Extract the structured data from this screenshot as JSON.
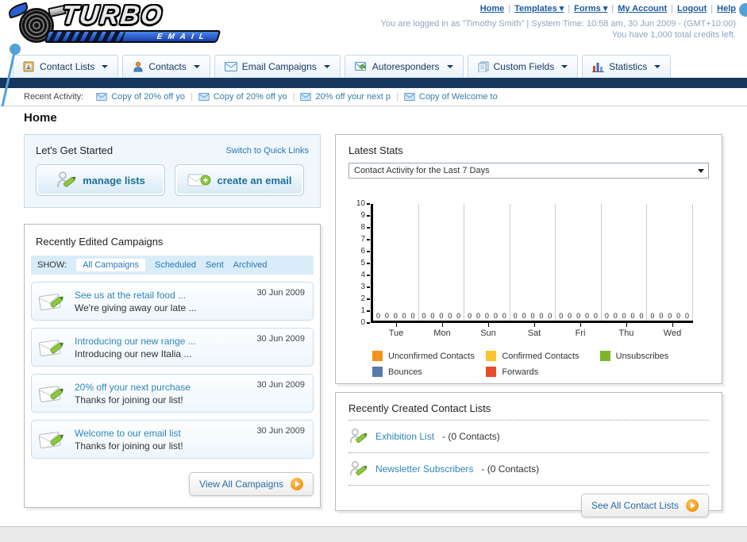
{
  "header": {
    "logo": {
      "title": "TURBO",
      "subtitle": "EMAIL"
    },
    "separator": "|",
    "nav_links": [
      {
        "label": "Home"
      },
      {
        "label": "Templates ▾"
      },
      {
        "label": "Forms ▾"
      },
      {
        "label": "My Account"
      },
      {
        "label": "Logout"
      },
      {
        "label": "Help"
      }
    ],
    "login_info": "You are logged in as \"Timothy Smith\" | System Time: 10:58 am, 30 Jun 2009 - (GMT+10:00)",
    "credits": "You have 1,000 total credits left."
  },
  "tabs": [
    {
      "label": "Contact Lists"
    },
    {
      "label": "Contacts"
    },
    {
      "label": "Email Campaigns"
    },
    {
      "label": "Autoresponders"
    },
    {
      "label": "Custom Fields"
    },
    {
      "label": "Statistics"
    }
  ],
  "activity": {
    "label": "Recent Activity:",
    "items": [
      {
        "label": "Copy of 20% off yo"
      },
      {
        "label": "Copy of 20% off yo"
      },
      {
        "label": "20% off your next p"
      },
      {
        "label": "Copy of Welcome to"
      }
    ]
  },
  "page_title": "Home",
  "get_started": {
    "title": "Let's Get Started",
    "switch_link": "Switch to Quick Links",
    "buttons": [
      {
        "label": "manage lists"
      },
      {
        "label": "create an email"
      }
    ]
  },
  "campaigns": {
    "title": "Recently Edited Campaigns",
    "show_label": "SHOW:",
    "filters": [
      "All Campaigns",
      "Scheduled",
      "Sent",
      "Archived"
    ],
    "active_filter": "All Campaigns",
    "items": [
      {
        "title": "See us at the retail food ...",
        "subtitle": "We're giving away our late ...",
        "date": "30 Jun 2009"
      },
      {
        "title": "Introducing our new range ...",
        "subtitle": "Introducing our new Italia ...",
        "date": "30 Jun 2009"
      },
      {
        "title": "20% off your next purchase",
        "subtitle": "Thanks for joining our list!",
        "date": "30 Jun 2009"
      },
      {
        "title": "Welcome to our email list",
        "subtitle": "Thanks for joining our list!",
        "date": "30 Jun 2009"
      }
    ],
    "view_all_label": "View All Campaigns"
  },
  "stats": {
    "title": "Latest Stats",
    "dropdown_value": "Contact Activity for the Last 7 Days"
  },
  "chart_data": {
    "type": "bar",
    "title": "Contact Activity for the Last 7 Days",
    "categories": [
      "Tue",
      "Mon",
      "Sun",
      "Sat",
      "Fri",
      "Thu",
      "Wed"
    ],
    "series": [
      {
        "name": "Unconfirmed Contacts",
        "color": "#f5921e",
        "values": [
          0,
          0,
          0,
          0,
          0,
          0,
          0
        ]
      },
      {
        "name": "Confirmed Contacts",
        "color": "#fbc32d",
        "values": [
          0,
          0,
          0,
          0,
          0,
          0,
          0
        ]
      },
      {
        "name": "Unsubscribes",
        "color": "#7fb42a",
        "values": [
          0,
          0,
          0,
          0,
          0,
          0,
          0
        ]
      },
      {
        "name": "Bounces",
        "color": "#5878ae",
        "values": [
          0,
          0,
          0,
          0,
          0,
          0,
          0
        ]
      },
      {
        "name": "Forwards",
        "color": "#e74c28",
        "values": [
          0,
          0,
          0,
          0,
          0,
          0,
          0
        ]
      }
    ],
    "xlabel": "",
    "ylabel": "",
    "ylim": [
      0,
      10
    ],
    "yticks": [
      0,
      1,
      2,
      3,
      4,
      5,
      6,
      7,
      8,
      9,
      10
    ],
    "grid": true,
    "legend_position": "bottom"
  },
  "contact_lists": {
    "title": "Recently Created Contact Lists",
    "items": [
      {
        "name": "Exhibition List",
        "detail": "- (0 Contacts)"
      },
      {
        "name": "Newsletter Subscribers",
        "detail": "- (0 Contacts)"
      }
    ],
    "see_all_label": "See All Contact Lists"
  }
}
